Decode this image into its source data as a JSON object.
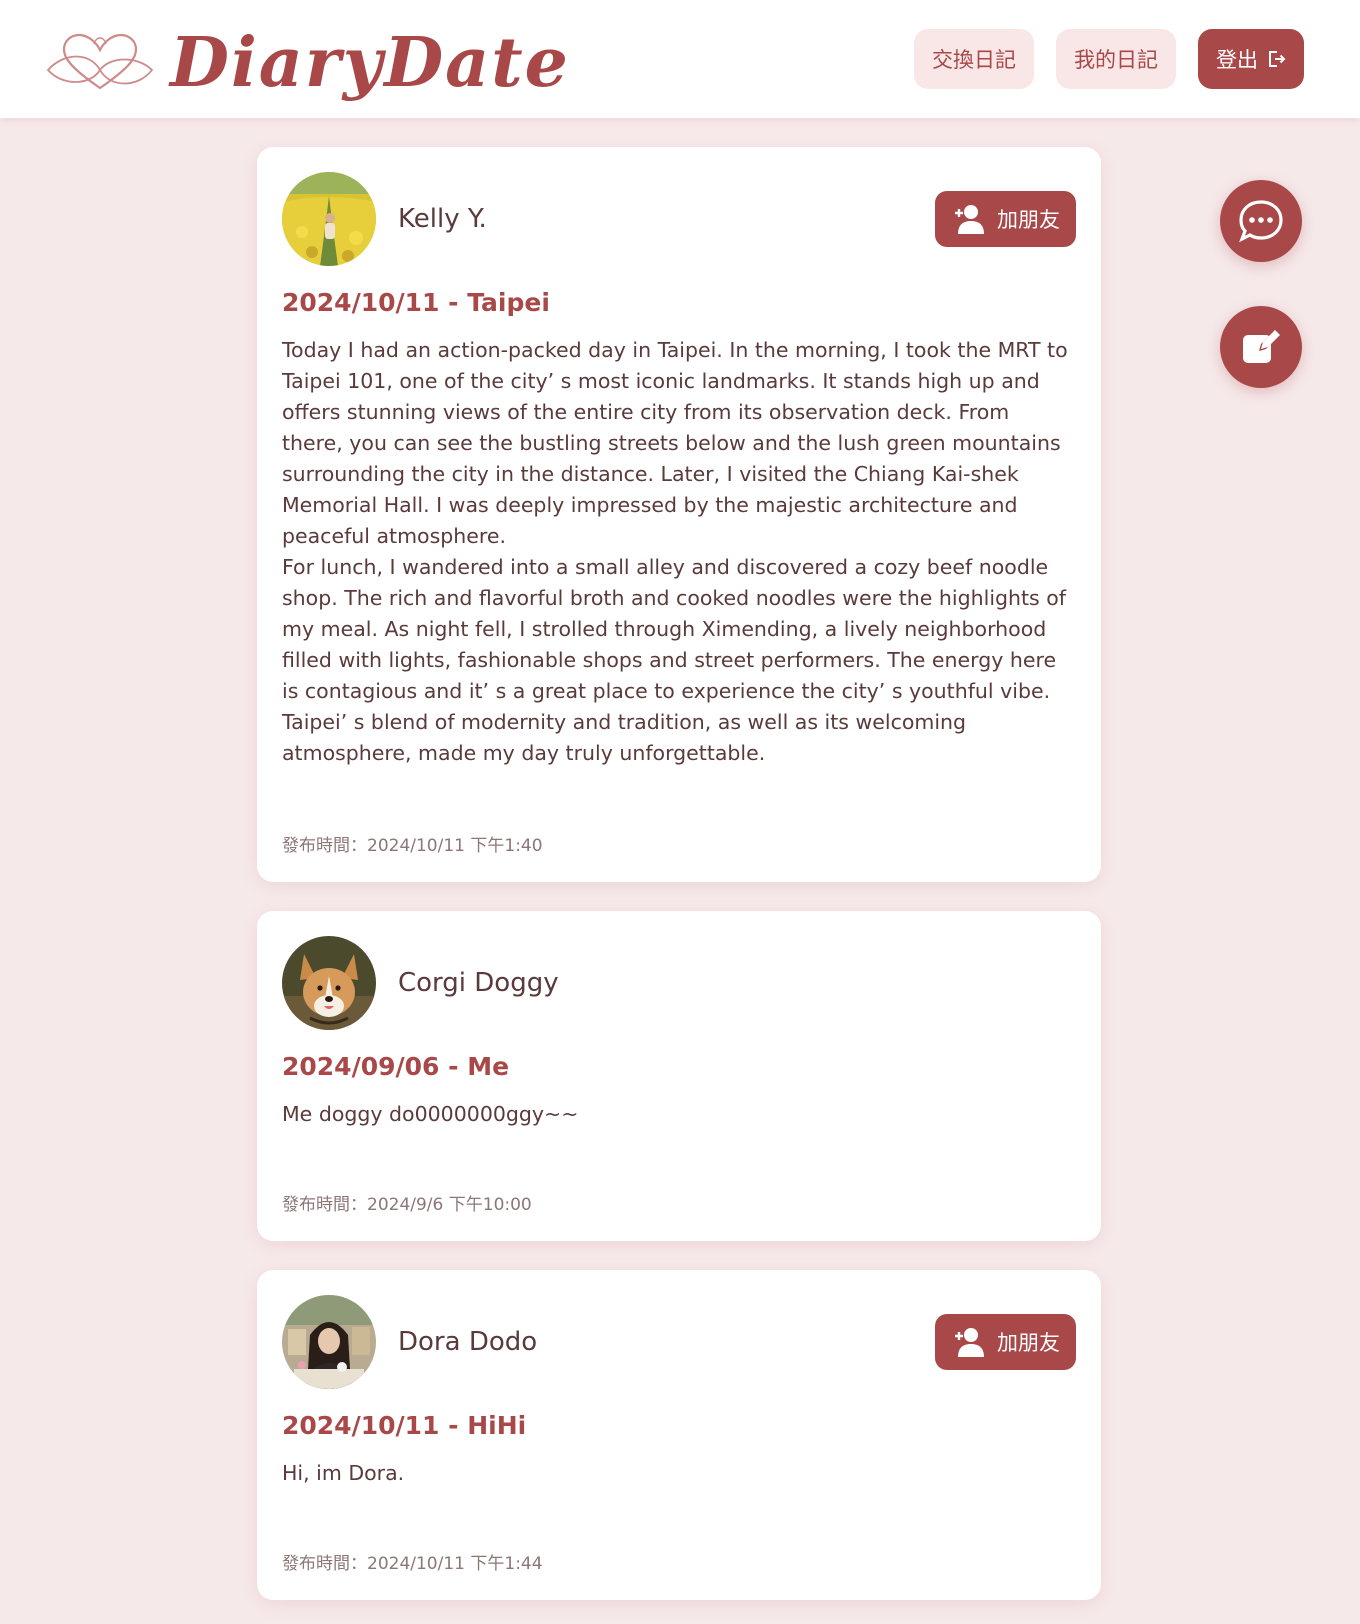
{
  "header": {
    "logo_text": "DiaryDate",
    "nav": {
      "exchange_label": "交換日記",
      "my_diary_label": "我的日記",
      "logout_label": "登出"
    }
  },
  "posts": [
    {
      "author": "Kelly Y.",
      "add_friend_label": "加朋友",
      "title": "2024/10/11 - Taipei",
      "body": "Today I had an action-packed day in Taipei. In the morning, I took the MRT to Taipei 101, one of the city’ s most iconic landmarks. It stands high up and offers stunning views of the entire city from its observation deck. From there, you can see the bustling streets below and the lush green mountains surrounding the city in the distance. Later, I visited the Chiang Kai-shek Memorial Hall. I was deeply impressed by the majestic architecture and peaceful atmosphere.\nFor lunch, I wandered into a small alley and discovered a cozy beef noodle shop. The rich and flavorful broth and cooked noodles were the highlights of my meal. As night fell, I strolled through Ximending, a lively neighborhood filled with lights, fashionable shops and street performers. The energy here is contagious and it’ s a great place to experience the city’ s youthful vibe. Taipei’ s blend of modernity and tradition, as well as its welcoming atmosphere, made my day truly unforgettable.",
      "time": "發布時間：2024/10/11 下午1:40"
    },
    {
      "author": "Corgi Doggy",
      "title": "2024/09/06 - Me",
      "body": "Me doggy do0000000ggy~~",
      "time": "發布時間：2024/9/6 下午10:00"
    },
    {
      "author": "Dora Dodo",
      "add_friend_label": "加朋友",
      "title": "2024/10/11 - HiHi",
      "body": "Hi, im Dora.",
      "time": "發布時間：2024/10/11 下午1:44"
    }
  ],
  "icons": {
    "logo": "heart-infinity-icon",
    "logout": "logout-icon",
    "add_friend": "add-user-icon",
    "chat": "chat-bubble-icon",
    "edit": "edit-square-icon"
  },
  "colors": {
    "accent": "#a84848",
    "page_background": "#f6e9ea",
    "nav_button_background": "#f9e6e6",
    "text": "#5a3a3a",
    "muted_text": "#8c7676"
  }
}
